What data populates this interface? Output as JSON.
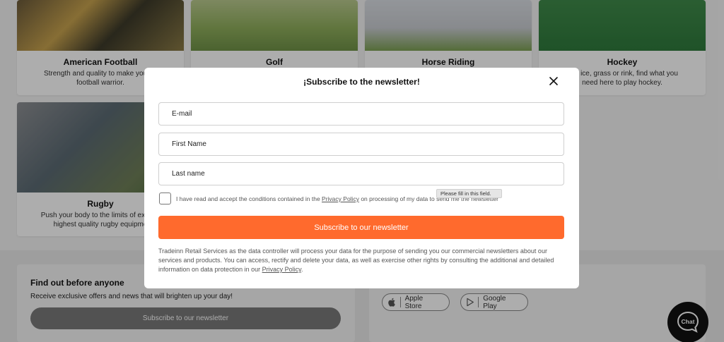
{
  "background": {
    "categories": [
      {
        "title": "American Football",
        "desc_line1": "Strength and quality to make you an",
        "desc_line2": "football warrior."
      },
      {
        "title": "Golf"
      },
      {
        "title": "Horse Riding"
      },
      {
        "title": "Hockey",
        "desc_line1": "r on ice, grass or rink, find what you",
        "desc_line2": "need here to play hockey."
      },
      {
        "title": "Rugby",
        "desc_line1": "Push your body to the limits of exercis",
        "desc_line2": "highest quality rugby equipme"
      }
    ],
    "newsletter_box": {
      "heading": "Find out before anyone",
      "subtext": "Receive exclusive offers and news that will brighten up your day!",
      "button_label": "Subscribe to our newsletter"
    },
    "apps": {
      "apple_label": "Apple Store",
      "google_label": "Google Play"
    },
    "chat_label": "Chat"
  },
  "modal": {
    "title": "¡Subscribe to the newsletter!",
    "fields": {
      "email_placeholder": "E-mail",
      "first_name_placeholder": "First Name",
      "last_name_placeholder": "Last name"
    },
    "consent": {
      "text_before": "I have read and accept the conditions contained in the ",
      "link": "Privacy Policy",
      "text_after": " on processing of my data to send me the newsletter"
    },
    "tooltip": "Please fill in this field.",
    "submit_label": "Subscribe to our newsletter",
    "legal": {
      "text": "Tradeinn Retail Services as the data controller will process your data for the purpose of sending you our commercial newsletters about our services and products. You can access, rectify and delete your data, as well as exercise other rights by consulting the additional and detailed information on data protection in our ",
      "link": "Privacy Policy",
      "end": "."
    }
  },
  "colors": {
    "accent": "#ff6a2d",
    "overlay": "rgba(0,0,0,0.32)"
  }
}
